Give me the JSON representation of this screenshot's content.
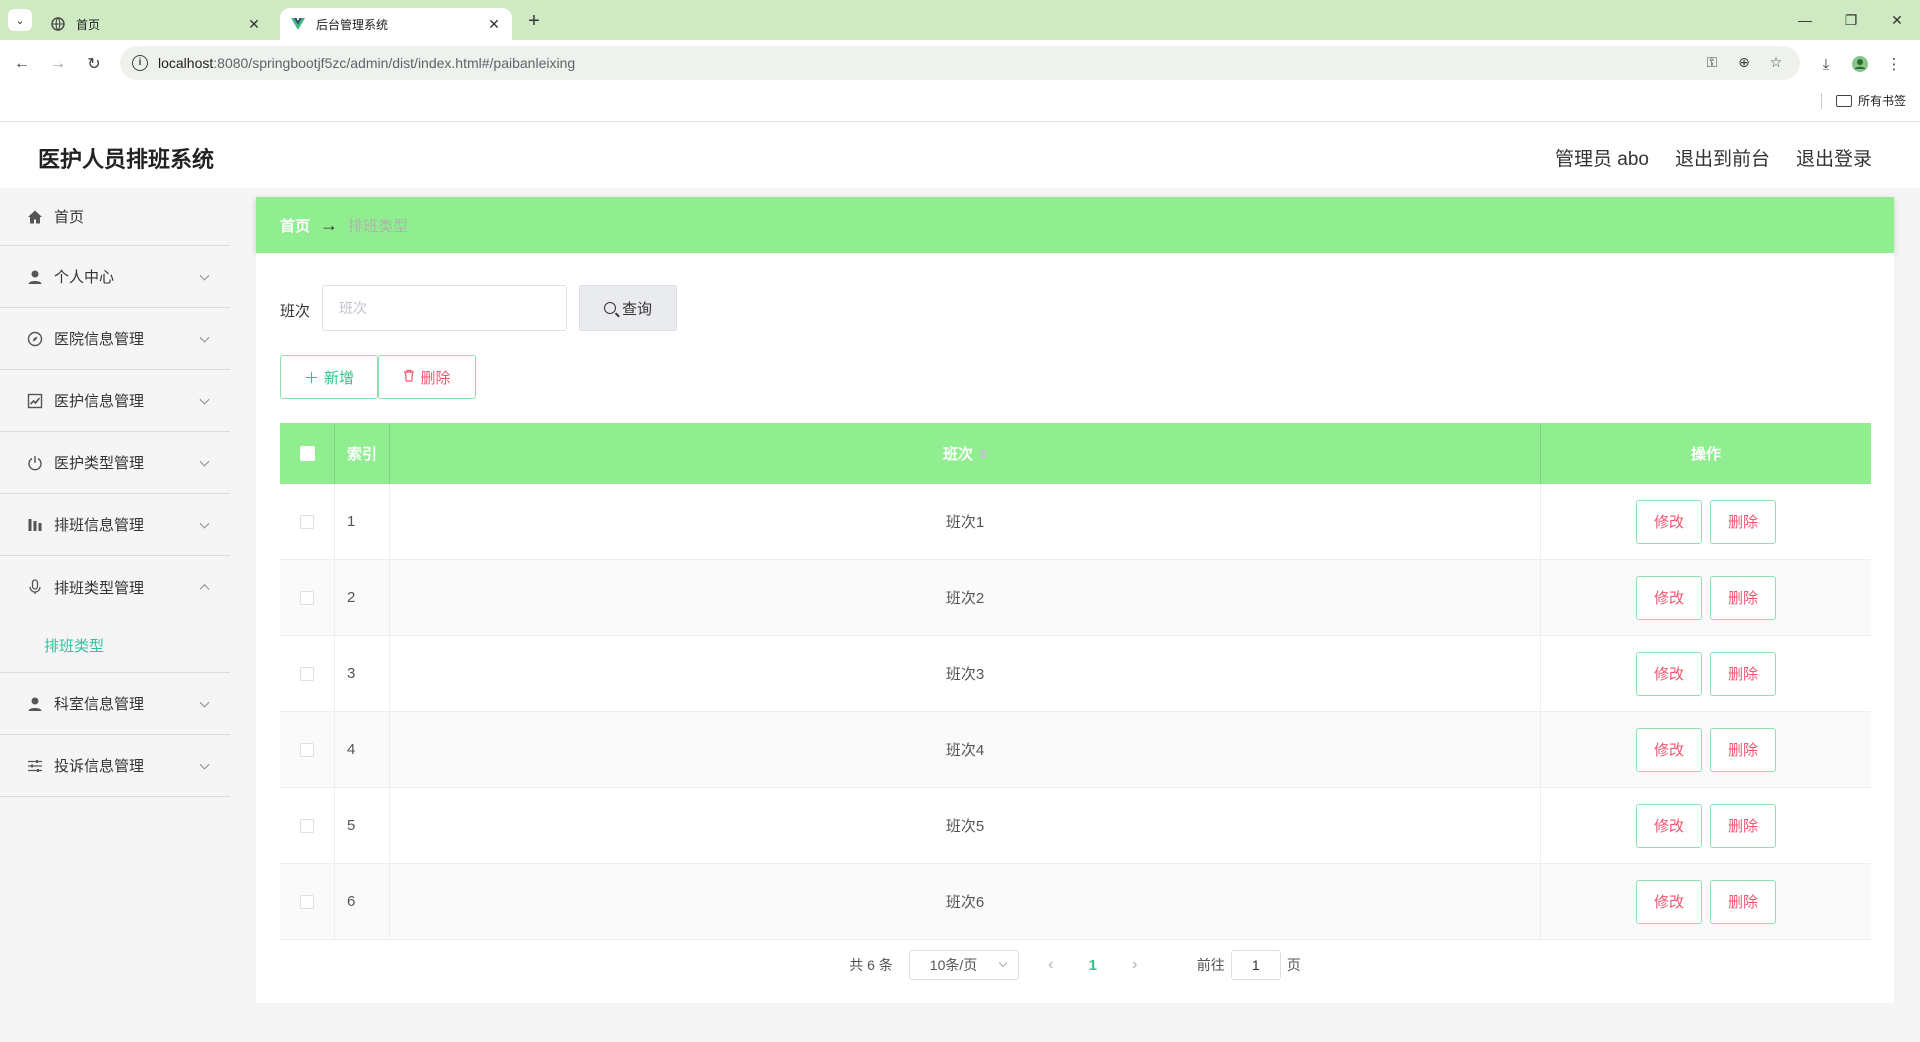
{
  "browser": {
    "tabs": [
      {
        "title": "首页",
        "active": false
      },
      {
        "title": "后台管理系统",
        "active": true
      }
    ],
    "url_host": "localhost",
    "url_rest": ":8080/springbootjf5zc/admin/dist/index.html#/paibanleixing",
    "bookmarks_label": "所有书签"
  },
  "header": {
    "title": "医护人员排班系统",
    "user": "管理员 abo",
    "to_front": "退出到前台",
    "logout": "退出登录"
  },
  "sidebar": {
    "items": [
      {
        "label": "首页",
        "icon": "home-icon"
      },
      {
        "label": "个人中心",
        "icon": "user-icon"
      },
      {
        "label": "医院信息管理",
        "icon": "compass-icon"
      },
      {
        "label": "医护信息管理",
        "icon": "chart-icon"
      },
      {
        "label": "医护类型管理",
        "icon": "power-icon"
      },
      {
        "label": "排班信息管理",
        "icon": "stats-icon"
      },
      {
        "label": "排班类型管理",
        "icon": "microphone-icon"
      },
      {
        "label": "科室信息管理",
        "icon": "user-icon"
      },
      {
        "label": "投诉信息管理",
        "icon": "sliders-icon"
      }
    ],
    "submenu_active": "排班类型"
  },
  "breadcrumb": {
    "home": "首页",
    "arrow": "→",
    "current": "排班类型"
  },
  "search": {
    "label": "班次",
    "placeholder": "班次",
    "button": "查询"
  },
  "actions": {
    "add": "新增",
    "delete": "删除"
  },
  "table": {
    "columns": [
      "索引",
      "班次",
      "操作"
    ],
    "rows": [
      {
        "index": "1",
        "name": "班次1"
      },
      {
        "index": "2",
        "name": "班次2"
      },
      {
        "index": "3",
        "name": "班次3"
      },
      {
        "index": "4",
        "name": "班次4"
      },
      {
        "index": "5",
        "name": "班次5"
      },
      {
        "index": "6",
        "name": "班次6"
      }
    ],
    "edit_label": "修改",
    "delete_label": "删除"
  },
  "pagination": {
    "total": "共 6 条",
    "page_size": "10条/页",
    "current_page": "1",
    "goto_label": "前往",
    "goto_value": "1",
    "page_suffix": "页"
  },
  "colors": {
    "accent_green": "#90ee90",
    "active_text": "#2ec4a0",
    "danger_text": "#f0566e"
  }
}
